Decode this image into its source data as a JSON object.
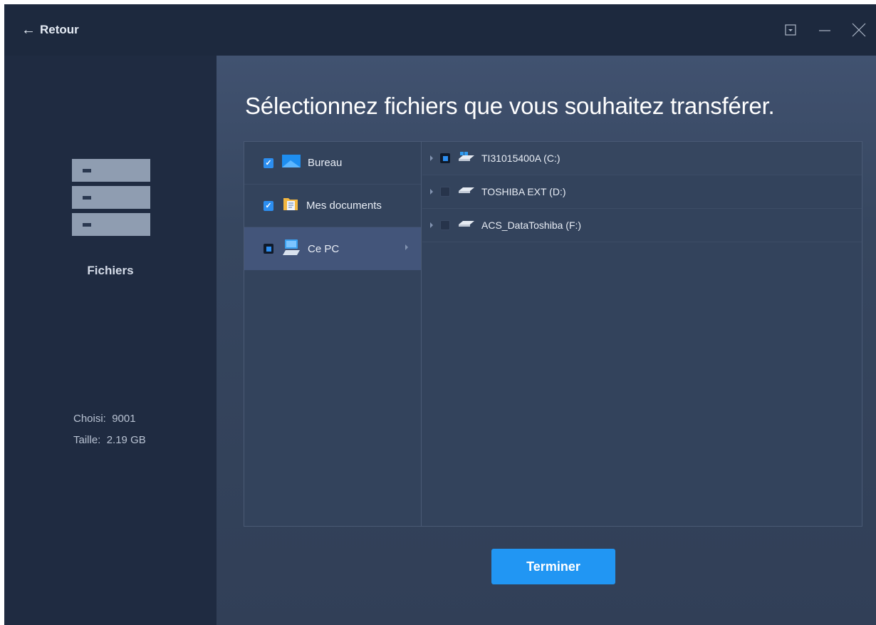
{
  "titlebar": {
    "back_label": "Retour",
    "controls": [
      "dropdown-icon",
      "minimize-icon",
      "close-icon"
    ]
  },
  "sidebar": {
    "category_name": "Fichiers",
    "category_icon": "file-cabinet-icon",
    "chosen_label": "Choisi:",
    "chosen_value": "9001",
    "size_label": "Taille:",
    "size_value": "2.19 GB"
  },
  "main": {
    "heading": "Sélectionnez fichiers que vous souhaitez transférer.",
    "locations": [
      {
        "label": "Bureau",
        "state": "checked",
        "icon": "desktop-icon"
      },
      {
        "label": "Mes documents",
        "state": "checked",
        "icon": "documents-folder-icon"
      },
      {
        "label": "Ce PC",
        "state": "partial",
        "icon": "computer-icon",
        "selected": true
      }
    ],
    "drives": [
      {
        "label": "TI31015400A (C:)",
        "state": "partial",
        "icon": "system-drive-icon"
      },
      {
        "label": "TOSHIBA EXT (D:)",
        "state": "unchecked",
        "icon": "drive-icon"
      },
      {
        "label": "ACS_DataToshiba (F:)",
        "state": "unchecked",
        "icon": "drive-icon"
      }
    ],
    "finish_label": "Terminer"
  },
  "colors": {
    "background_dark": "#1e2a3f",
    "panel": "#33435c",
    "accent": "#2196f3",
    "checkbox_blue": "#2c8ef0"
  }
}
